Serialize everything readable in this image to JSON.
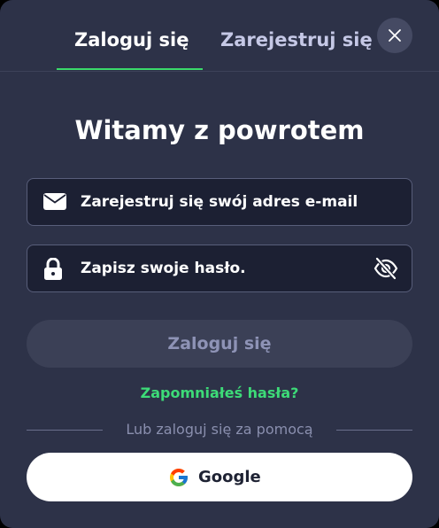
{
  "tabs": {
    "login": "Zaloguj się",
    "register": "Zarejestruj się",
    "active": "login"
  },
  "title": "Witamy z powrotem",
  "email_field": {
    "placeholder": "Zarejestruj się swój adres e-mail",
    "value": "",
    "icon": "envelope-icon"
  },
  "password_field": {
    "placeholder": "Zapisz swoje hasło.",
    "value": "",
    "icon": "lock-icon",
    "toggle_icon": "eye-off-icon"
  },
  "login_button": "Zaloguj się",
  "forgot_password": "Zapomniałeś hasła?",
  "divider_text": "Lub zaloguj się za pomocą",
  "google_button": {
    "label": "Google",
    "icon": "google-logo-icon"
  },
  "colors": {
    "background": "#2d3248",
    "accent_green": "#3ddb78",
    "field_background": "#1c2033",
    "login_button_background": "#3b4056"
  }
}
